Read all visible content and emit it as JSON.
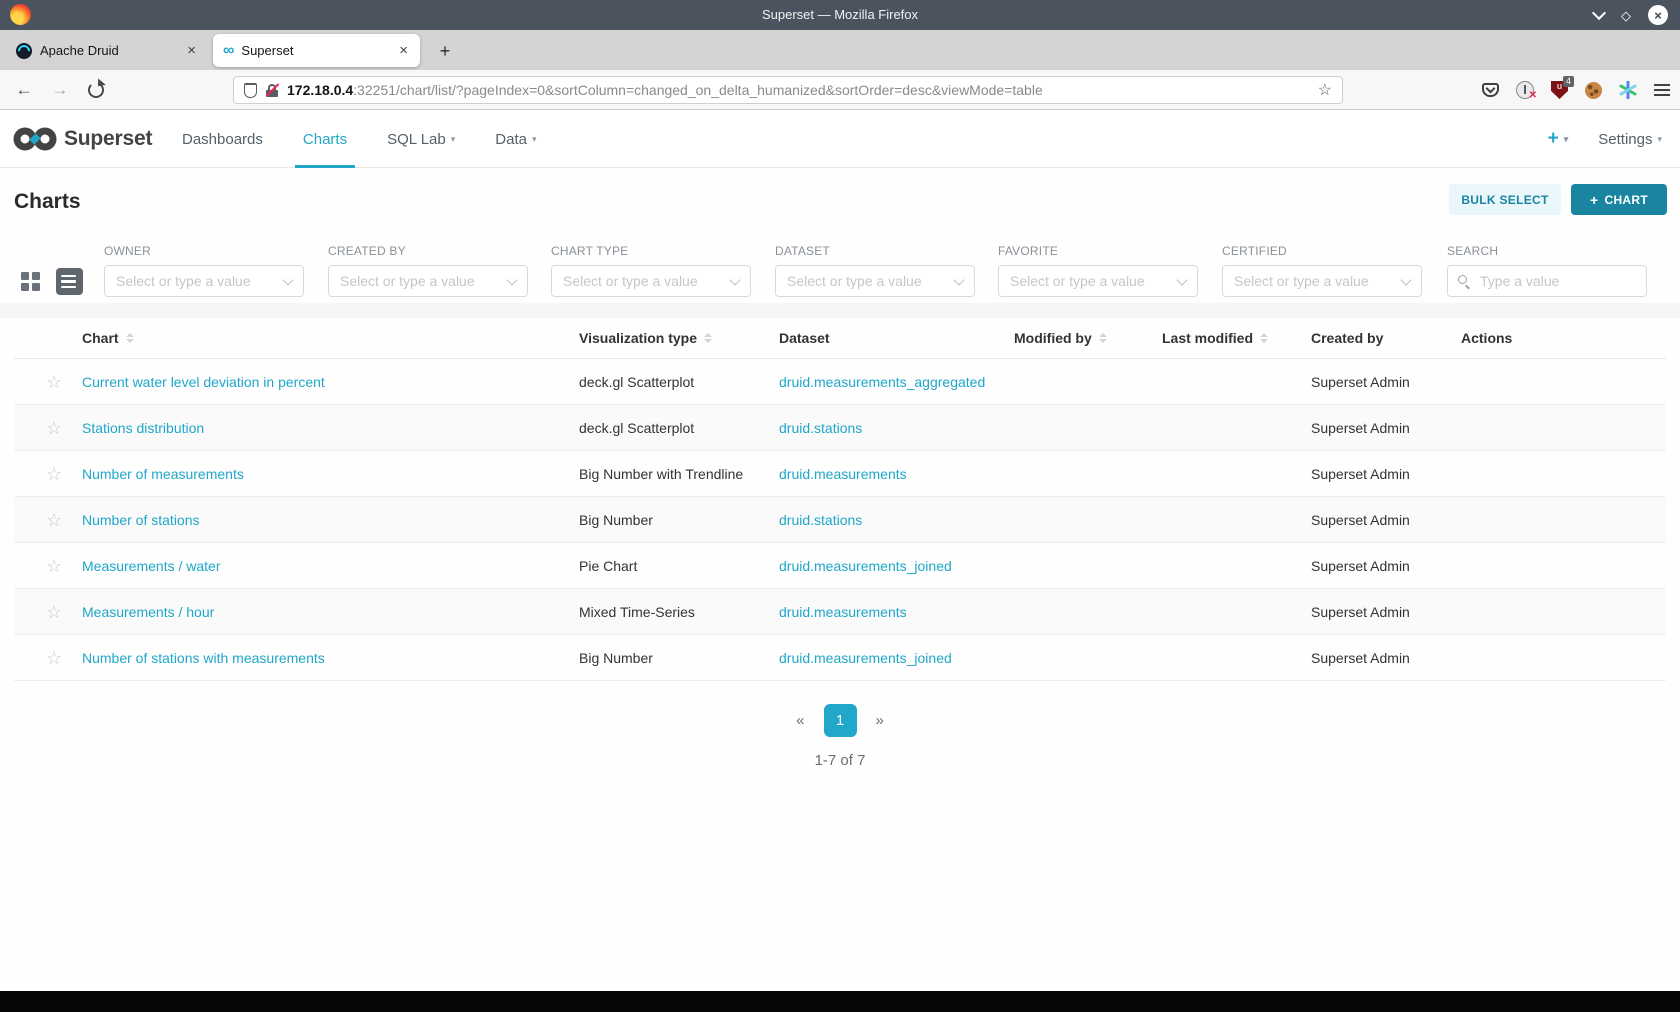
{
  "browser": {
    "window_title": "Superset — Mozilla Firefox",
    "tabs": [
      {
        "title": "Apache Druid",
        "active": false
      },
      {
        "title": "Superset",
        "active": true
      }
    ],
    "new_tab_label": "+",
    "url": {
      "host": "172.18.0.4",
      "rest": ":32251/chart/list/?pageIndex=0&sortColumn=changed_on_delta_humanized&sortOrder=desc&viewMode=table"
    },
    "extension_badge": "4"
  },
  "superset_nav": {
    "brand": "Superset",
    "items": [
      {
        "label": "Dashboards",
        "active": false,
        "caret": false
      },
      {
        "label": "Charts",
        "active": true,
        "caret": false
      },
      {
        "label": "SQL Lab",
        "active": false,
        "caret": true
      },
      {
        "label": "Data",
        "active": false,
        "caret": true
      }
    ],
    "plus_label": "+",
    "settings_label": "Settings"
  },
  "page": {
    "title": "Charts",
    "bulk_select_label": "BULK SELECT",
    "add_chart_label": "CHART",
    "add_chart_plus": "+"
  },
  "filters": [
    {
      "label": "OWNER",
      "placeholder": "Select or type a value"
    },
    {
      "label": "CREATED BY",
      "placeholder": "Select or type a value"
    },
    {
      "label": "CHART TYPE",
      "placeholder": "Select or type a value"
    },
    {
      "label": "DATASET",
      "placeholder": "Select or type a value"
    },
    {
      "label": "FAVORITE",
      "placeholder": "Select or type a value"
    },
    {
      "label": "CERTIFIED",
      "placeholder": "Select or type a value"
    },
    {
      "label": "SEARCH",
      "placeholder": "Type a value"
    }
  ],
  "table": {
    "columns": [
      {
        "label": "Chart",
        "sortable": true
      },
      {
        "label": "Visualization type",
        "sortable": true
      },
      {
        "label": "Dataset",
        "sortable": false
      },
      {
        "label": "Modified by",
        "sortable": true
      },
      {
        "label": "Last modified",
        "sortable": true
      },
      {
        "label": "Created by",
        "sortable": false
      },
      {
        "label": "Actions",
        "sortable": false
      }
    ],
    "rows": [
      {
        "chart": "Current water level deviation in percent",
        "viz": "deck.gl Scatterplot",
        "dataset": "druid.measurements_aggregated",
        "modified_by": "",
        "last_modified": "",
        "created_by": "Superset Admin"
      },
      {
        "chart": "Stations distribution",
        "viz": "deck.gl Scatterplot",
        "dataset": "druid.stations",
        "modified_by": "",
        "last_modified": "",
        "created_by": "Superset Admin"
      },
      {
        "chart": "Number of measurements",
        "viz": "Big Number with Trendline",
        "dataset": "druid.measurements",
        "modified_by": "",
        "last_modified": "",
        "created_by": "Superset Admin"
      },
      {
        "chart": "Number of stations",
        "viz": "Big Number",
        "dataset": "druid.stations",
        "modified_by": "",
        "last_modified": "",
        "created_by": "Superset Admin"
      },
      {
        "chart": "Measurements / water",
        "viz": "Pie Chart",
        "dataset": "druid.measurements_joined",
        "modified_by": "",
        "last_modified": "",
        "created_by": "Superset Admin"
      },
      {
        "chart": "Measurements / hour",
        "viz": "Mixed Time-Series",
        "dataset": "druid.measurements",
        "modified_by": "",
        "last_modified": "",
        "created_by": "Superset Admin"
      },
      {
        "chart": "Number of stations with measurements",
        "viz": "Big Number",
        "dataset": "druid.measurements_joined",
        "modified_by": "",
        "last_modified": "",
        "created_by": "Superset Admin"
      }
    ]
  },
  "pagination": {
    "prev": "«",
    "current_page": "1",
    "next": "»",
    "summary": "1-7 of 7"
  },
  "colors": {
    "accent": "#20a7c9",
    "accent_dark": "#1a85a0",
    "titlebar": "#4b545e"
  }
}
